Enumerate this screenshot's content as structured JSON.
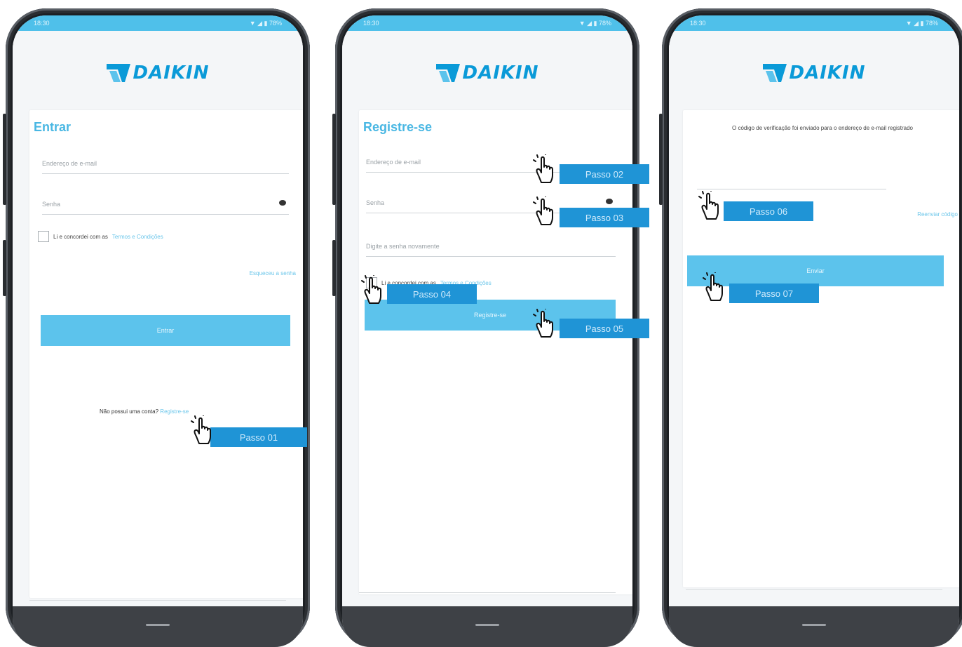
{
  "brand": {
    "name": "DAIKIN",
    "color": "#0a9ad8"
  },
  "accent_color": "#5cc3ec",
  "step_color": "#1f94d6",
  "phones": [
    {
      "status": {
        "time": "18:30",
        "battery": "78%"
      },
      "title": "Entrar",
      "email_placeholder": "Endereço de e-mail",
      "password_placeholder": "Senha",
      "terms_text": "Li e concordei com as",
      "terms_link": "Termos e Condições",
      "forgot_password": "Esqueceu a senha",
      "button": "Entrar",
      "no_account": "Não possui uma conta?",
      "register_link": "Registre-se"
    },
    {
      "status": {
        "time": "18:30",
        "battery": "78%"
      },
      "title": "Registre-se",
      "email_placeholder": "Endereço de e-mail",
      "password_placeholder": "Senha",
      "confirm_placeholder": "Digite a senha novamente",
      "terms_text": "Li e concordei com as",
      "terms_link": "Termos e Condições",
      "button": "Registre-se"
    },
    {
      "status": {
        "time": "18:30",
        "battery": "78%"
      },
      "message": "O código de verificação foi enviado para o endereço de e-mail registrado",
      "resend": "Reenviar código",
      "button": "Enviar"
    }
  ],
  "steps": [
    "Passo 01",
    "Passo 02",
    "Passo 03",
    "Passo 04",
    "Passo 05",
    "Passo 06",
    "Passo 07"
  ],
  "icons": [
    "pointing-hand-icon",
    "eye-icon",
    "wifi-icon",
    "battery-icon"
  ]
}
